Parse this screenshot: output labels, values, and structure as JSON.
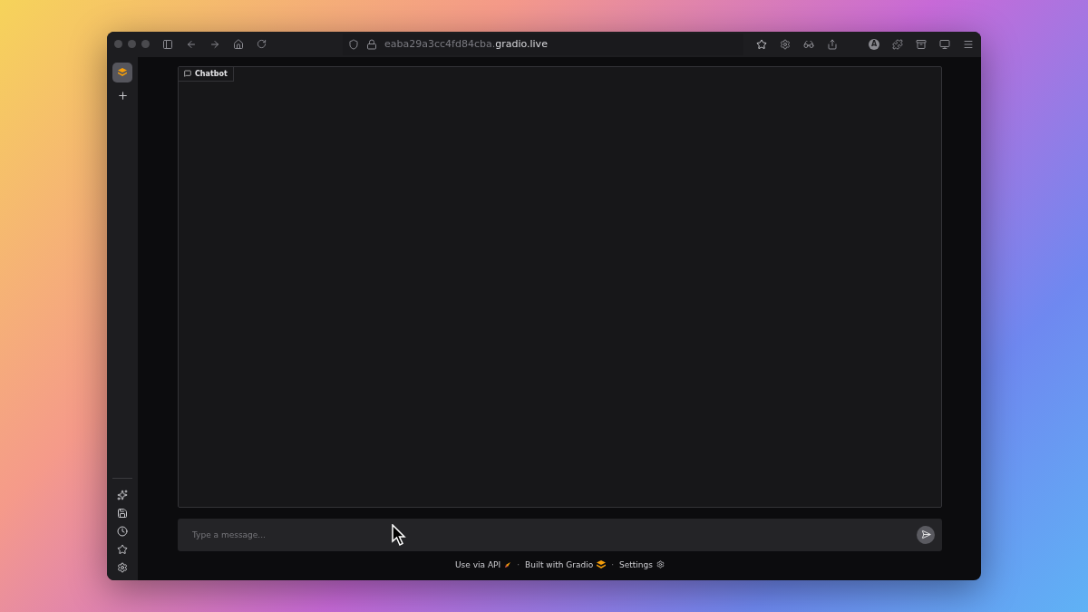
{
  "browser": {
    "url": "eaba29a3cc4fd84cba.**gradio.live**",
    "profile_initial": "A"
  },
  "chatbot": {
    "label": "Chatbot"
  },
  "input": {
    "placeholder": "Type a message..."
  },
  "footer": [
    {
      "kind": "api",
      "label": "Use via API"
    },
    {
      "kind": "gradio",
      "label": "Built with Gradio"
    },
    {
      "kind": "settings",
      "label": "Settings"
    }
  ],
  "separator": "·"
}
